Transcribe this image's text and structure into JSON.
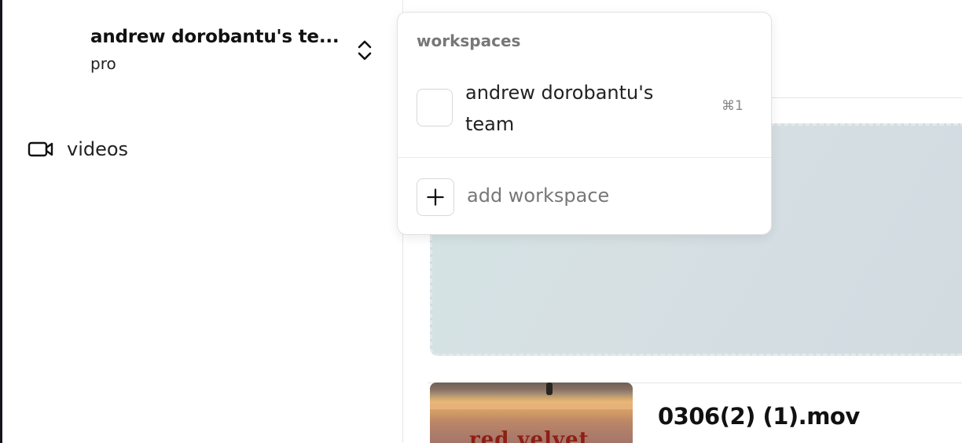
{
  "sidebar": {
    "team": {
      "name": "andrew dorobantu's te...",
      "plan": "pro",
      "switcher_icon": "chevron-up-down-icon"
    },
    "nav": [
      {
        "label": "videos",
        "icon": "video-camera-icon"
      }
    ]
  },
  "main": {
    "videos": [
      {
        "title": "0306(2) (1).mov",
        "thumbnail_text": "red velvet"
      }
    ]
  },
  "dropdown": {
    "header": "workspaces",
    "workspaces": [
      {
        "name": "andrew dorobantu's team",
        "shortcut": "⌘1"
      }
    ],
    "add_label": "add workspace",
    "add_icon": "plus-icon"
  },
  "colors": {
    "left_edge": "#15151c",
    "dropzone_bg": "#d4e0e3",
    "thumbnail_text": "#8e1e14"
  }
}
